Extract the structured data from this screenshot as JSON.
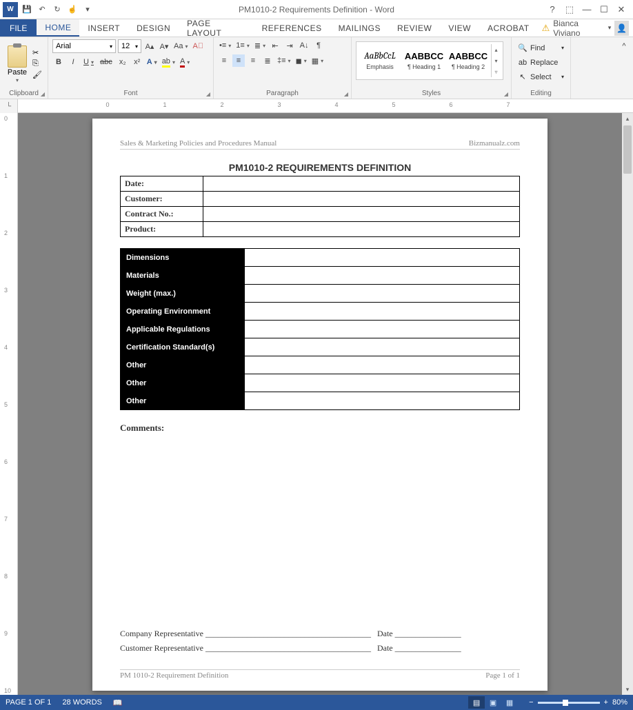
{
  "app": {
    "title": "PM1010-2 Requirements Definition - Word"
  },
  "user": {
    "name": "Bianca Viviano"
  },
  "tabs": {
    "file": "FILE",
    "home": "HOME",
    "insert": "INSERT",
    "design": "DESIGN",
    "page_layout": "PAGE LAYOUT",
    "references": "REFERENCES",
    "mailings": "MAILINGS",
    "review": "REVIEW",
    "view": "VIEW",
    "acrobat": "ACROBAT"
  },
  "ribbon": {
    "clipboard": {
      "label": "Clipboard",
      "paste": "Paste"
    },
    "font": {
      "label": "Font",
      "family": "Arial",
      "size": "12",
      "bold": "B",
      "italic": "I",
      "underline": "U",
      "strike": "abc",
      "sub": "x₂",
      "sup": "x²"
    },
    "paragraph": {
      "label": "Paragraph"
    },
    "styles": {
      "label": "Styles",
      "items": [
        {
          "sample": "AaBbCcL",
          "name": "Emphasis"
        },
        {
          "sample": "AABBCC",
          "name": "¶ Heading 1"
        },
        {
          "sample": "AABBCC",
          "name": "¶ Heading 2"
        }
      ]
    },
    "editing": {
      "label": "Editing",
      "find": "Find",
      "replace": "Replace",
      "select": "Select"
    }
  },
  "document": {
    "header_left": "Sales & Marketing Policies and Procedures Manual",
    "header_right": "Bizmanualz.com",
    "title": "PM1010-2 REQUIREMENTS DEFINITION",
    "info_rows": [
      {
        "label": "Date:"
      },
      {
        "label": "Customer:"
      },
      {
        "label": "Contract No.:"
      },
      {
        "label": "Product:"
      }
    ],
    "spec_rows": [
      "Dimensions",
      "Materials",
      "Weight (max.)",
      "Operating Environment",
      "Applicable Regulations",
      "Certification Standard(s)",
      "Other",
      "Other",
      "Other"
    ],
    "comments_label": "Comments:",
    "sig1_label": "Company Representative",
    "sig2_label": "Customer Representative",
    "sig_date": "Date",
    "footer_left": "PM 1010-2 Requirement Definition",
    "footer_right": "Page 1 of 1"
  },
  "status": {
    "page": "PAGE 1 OF 1",
    "words": "28 WORDS",
    "zoom": "80%"
  }
}
